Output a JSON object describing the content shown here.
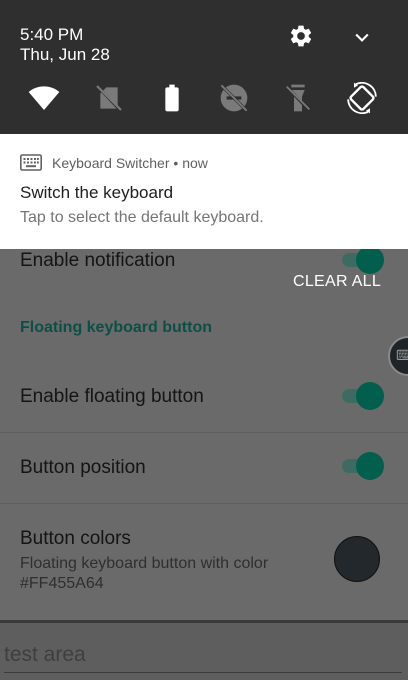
{
  "status": {
    "time": "5:40 PM",
    "date": "Thu, Jun 28"
  },
  "quick_settings": [
    {
      "icon": "wifi-icon"
    },
    {
      "icon": "no-sim-icon"
    },
    {
      "icon": "battery-icon"
    },
    {
      "icon": "do-not-disturb-off-icon"
    },
    {
      "icon": "flashlight-off-icon"
    },
    {
      "icon": "auto-rotate-icon"
    }
  ],
  "notification": {
    "app_name": "Keyboard Switcher",
    "separator": "•",
    "when": "now",
    "title": "Switch the keyboard",
    "text": "Tap to select the default keyboard."
  },
  "clear_all": "CLEAR ALL",
  "settings": {
    "enable_notification": {
      "label": "Enable notification",
      "on": true
    },
    "section_title": "Floating keyboard button",
    "enable_floating": {
      "label": "Enable floating button",
      "on": true
    },
    "button_position": {
      "label": "Button position",
      "on": true
    },
    "button_colors": {
      "label": "Button colors",
      "summary_line1": "Floating keyboard button with color",
      "summary_line2": "#FF455A64",
      "swatch_color": "#22282C"
    }
  },
  "test_area": {
    "placeholder": "test area"
  },
  "colors": {
    "accent": "#025E4D",
    "shade": "#2F2F2F"
  }
}
